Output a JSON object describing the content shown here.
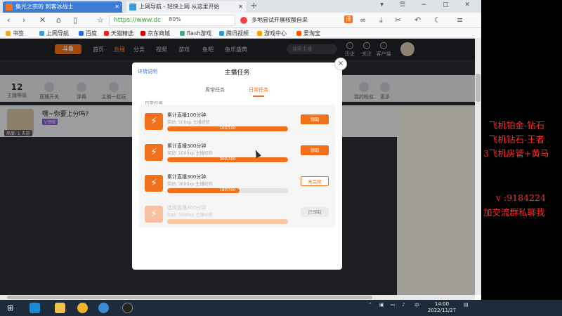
{
  "browser": {
    "tabs": [
      {
        "title": "集光之宗的 刺客冰战士",
        "active": true
      },
      {
        "title": "上网导航 - 轻快上网 从这里开始",
        "active": false
      }
    ],
    "url": "https://www.dc",
    "zoom": "80%",
    "search_text": "多地尝试开展核酸自采",
    "bookmarks": [
      "书签",
      "上网导航",
      "百度",
      "天猫精选",
      "京东商城",
      "flash游戏",
      "腾讯视频",
      "游戏中心",
      "爱淘宝"
    ]
  },
  "site": {
    "logo": "斗鱼",
    "nav": [
      "首页",
      "直播",
      "分类",
      "视频",
      "游戏",
      "鱼吧",
      "鱼乐盛典"
    ],
    "active_nav": "直播",
    "search_placeholder": "搜索主播",
    "right_icons": [
      "历史",
      "关注",
      "客户端"
    ],
    "stats": [
      {
        "num": "12",
        "label": "主播等级"
      },
      {
        "label": "直播开关"
      },
      {
        "label": "弹幕"
      },
      {
        "label": "主播一起玩"
      },
      {
        "label": "我的粉丝"
      },
      {
        "label": "更多"
      }
    ],
    "stream_title": "嘿~你要上分吗?",
    "stream_tag": "V领骑",
    "stream_time": "热度: 1 天前"
  },
  "modal": {
    "help": "详情说明",
    "title": "主播任务",
    "tabs": [
      "周常任务",
      "日常任务"
    ],
    "active_tab": "日常任务",
    "section": "日常任务",
    "close": "×",
    "tasks": [
      {
        "name": "累计直播100分钟",
        "reward": "奖励: 500xp 主播经验",
        "progress_text": "100/100",
        "progress": 1.0,
        "button": "领取",
        "state": "claim"
      },
      {
        "name": "累计直播300分钟",
        "reward": "奖励: 1500xp 主播经验",
        "progress_text": "300/300",
        "progress": 1.0,
        "button": "领取",
        "state": "claim"
      },
      {
        "name": "累计直播300分钟",
        "reward": "奖励: 3000xp 主播经验",
        "progress_text": "180/300",
        "progress": 0.6,
        "button": "未完成",
        "state": "pending"
      },
      {
        "name": "连续直播300分钟",
        "reward": "奖励: 5000xp 主播经验",
        "progress_text": "",
        "progress": 1.0,
        "button": "已领取",
        "state": "done"
      }
    ]
  },
  "promo_lines": [
    "飞机铂金-钻石",
    "飞机钻石-王者",
    "3飞机房管+黄马",
    "v  :9184224",
    "加交流群私聊我"
  ],
  "taskbar": {
    "time": "14:00",
    "date": "2022/11/27",
    "ime": "中"
  },
  "colors": {
    "accent": "#f2701a",
    "promo": "#ff2d2d"
  }
}
